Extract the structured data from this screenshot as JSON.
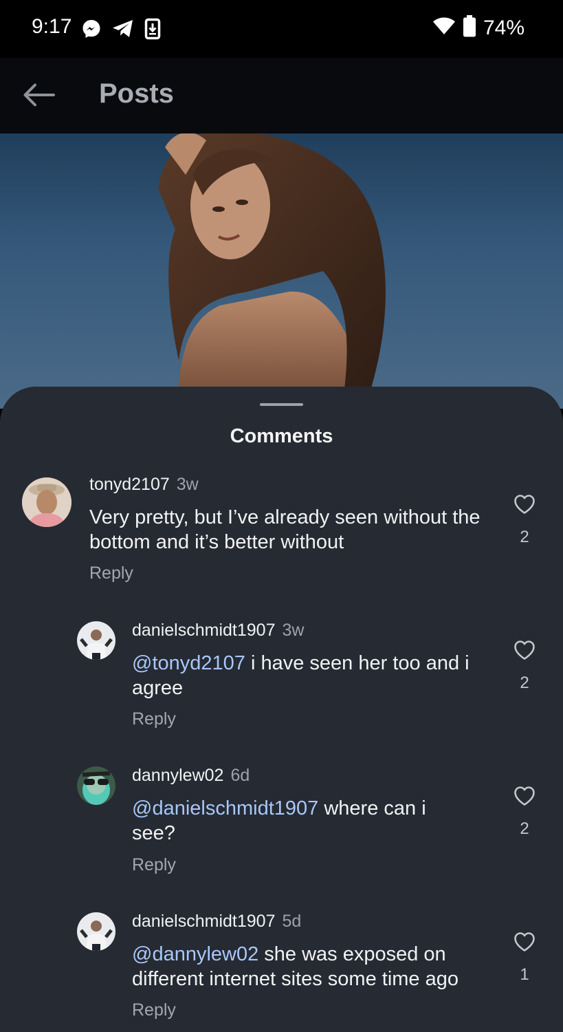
{
  "status_bar": {
    "time": "9:17",
    "battery": "74%",
    "icons": [
      "messenger-icon",
      "telegram-icon",
      "download-icon",
      "wifi-icon",
      "battery-icon"
    ]
  },
  "app_bar": {
    "title": "Posts",
    "back_icon": "arrow-left-icon"
  },
  "comments_sheet": {
    "title": "Comments",
    "comments": [
      {
        "username": "tonyd2107",
        "time": "3w",
        "mention": "",
        "text": "Very pretty, but I’ve already seen without the bottom and it’s better without",
        "reply_label": "Reply",
        "likes": "2"
      },
      {
        "username": "danielschmidt1907",
        "time": "3w",
        "mention": "@tonyd2107",
        "text": " i have seen her too and i agree",
        "reply_label": "Reply",
        "likes": "2"
      },
      {
        "username": "dannylew02",
        "time": "6d",
        "mention": "@danielschmidt1907",
        "text": " where can i see?",
        "reply_label": "Reply",
        "likes": "2"
      },
      {
        "username": "danielschmidt1907",
        "time": "5d",
        "mention": "@dannylew02",
        "text": " she was exposed on different internet sites some time ago",
        "reply_label": "Reply",
        "likes": "1"
      }
    ]
  },
  "colors": {
    "sheet_bg": "#262a32",
    "mention": "#a8c7fa",
    "muted": "#9ea3ab"
  }
}
